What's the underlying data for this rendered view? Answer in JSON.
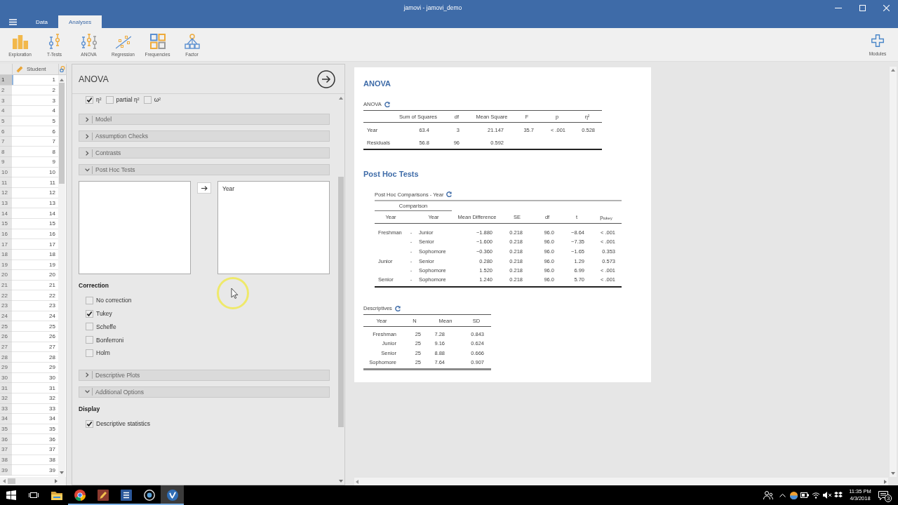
{
  "window": {
    "title": "jamovi - jamovi_demo"
  },
  "tabs": [
    {
      "label": "Data",
      "selected": false
    },
    {
      "label": "Analyses",
      "selected": true
    }
  ],
  "toolbar": {
    "items": [
      {
        "label": "Exploration",
        "kind": "exploration"
      },
      {
        "label": "T-Tests",
        "kind": "ttests"
      },
      {
        "label": "ANOVA",
        "kind": "anova"
      },
      {
        "label": "Regression",
        "kind": "regression"
      },
      {
        "label": "Frequencies",
        "kind": "frequencies"
      },
      {
        "label": "Factor",
        "kind": "factor"
      }
    ],
    "modules": {
      "label": "Modules"
    }
  },
  "spreadsheet": {
    "columns": [
      {
        "name": "Student",
        "kind": "continuous"
      },
      {
        "kind": "nominal"
      }
    ],
    "rows": [
      {
        "number": "1",
        "value": "1",
        "selected": true
      },
      {
        "number": "2",
        "value": "2",
        "selected": false
      },
      {
        "number": "3",
        "value": "3",
        "selected": false
      },
      {
        "number": "4",
        "value": "4",
        "selected": false
      },
      {
        "number": "5",
        "value": "5",
        "selected": false
      },
      {
        "number": "6",
        "value": "6",
        "selected": false
      },
      {
        "number": "7",
        "value": "7",
        "selected": false
      },
      {
        "number": "8",
        "value": "8",
        "selected": false
      },
      {
        "number": "9",
        "value": "9",
        "selected": false
      },
      {
        "number": "10",
        "value": "10",
        "selected": false
      },
      {
        "number": "11",
        "value": "11",
        "selected": false
      },
      {
        "number": "12",
        "value": "12",
        "selected": false
      },
      {
        "number": "13",
        "value": "13",
        "selected": false
      },
      {
        "number": "14",
        "value": "14",
        "selected": false
      },
      {
        "number": "15",
        "value": "15",
        "selected": false
      },
      {
        "number": "16",
        "value": "16",
        "selected": false
      },
      {
        "number": "17",
        "value": "17",
        "selected": false
      },
      {
        "number": "18",
        "value": "18",
        "selected": false
      },
      {
        "number": "19",
        "value": "19",
        "selected": false
      },
      {
        "number": "20",
        "value": "20",
        "selected": false
      },
      {
        "number": "21",
        "value": "21",
        "selected": false
      },
      {
        "number": "22",
        "value": "22",
        "selected": false
      },
      {
        "number": "23",
        "value": "23",
        "selected": false
      },
      {
        "number": "24",
        "value": "24",
        "selected": false
      },
      {
        "number": "25",
        "value": "25",
        "selected": false
      },
      {
        "number": "26",
        "value": "26",
        "selected": false
      },
      {
        "number": "27",
        "value": "27",
        "selected": false
      },
      {
        "number": "28",
        "value": "28",
        "selected": false
      },
      {
        "number": "29",
        "value": "29",
        "selected": false
      },
      {
        "number": "30",
        "value": "30",
        "selected": false
      },
      {
        "number": "31",
        "value": "31",
        "selected": false
      },
      {
        "number": "32",
        "value": "32",
        "selected": false
      },
      {
        "number": "33",
        "value": "33",
        "selected": false
      },
      {
        "number": "34",
        "value": "34",
        "selected": false
      },
      {
        "number": "35",
        "value": "35",
        "selected": false
      },
      {
        "number": "36",
        "value": "36",
        "selected": false
      },
      {
        "number": "37",
        "value": "37",
        "selected": false
      },
      {
        "number": "38",
        "value": "38",
        "selected": false
      },
      {
        "number": "39",
        "value": "39",
        "selected": false
      }
    ]
  },
  "options": {
    "title": "ANOVA",
    "effect_sizes": [
      {
        "label": "η²",
        "checked": true
      },
      {
        "label": "partial η²",
        "checked": false
      },
      {
        "label": "ω²",
        "checked": false
      }
    ],
    "sections": [
      {
        "label": "Model",
        "expanded": false
      },
      {
        "label": "Assumption Checks",
        "expanded": false
      },
      {
        "label": "Contrasts",
        "expanded": false
      },
      {
        "label": "Post Hoc Tests",
        "expanded": true,
        "terms": [
          "Year"
        ],
        "groups": [
          {
            "label": "Correction",
            "options": [
              {
                "label": "No correction",
                "checked": false
              },
              {
                "label": "Tukey",
                "checked": true
              },
              {
                "label": "Scheffe",
                "checked": false
              },
              {
                "label": "Bonferroni",
                "checked": false
              },
              {
                "label": "Holm",
                "checked": false
              }
            ]
          }
        ]
      },
      {
        "label": "Descriptive Plots",
        "expanded": false
      },
      {
        "label": "Additional Options",
        "expanded": true,
        "groups": [
          {
            "label": "Display",
            "options": [
              {
                "label": "Descriptive statistics",
                "checked": true
              }
            ]
          }
        ]
      }
    ]
  },
  "results": {
    "title": "ANOVA",
    "anova": {
      "title": "ANOVA",
      "columns": [
        "Sum of Squares",
        "df",
        "Mean Square",
        "F",
        "p",
        "η²"
      ],
      "rows": [
        {
          "term": "Year",
          "values": [
            "63.4",
            "3",
            "21.147",
            "35.7",
            "< .001",
            "0.528"
          ]
        },
        {
          "term": "Residuals",
          "values": [
            "56.8",
            "96",
            "0.592"
          ]
        }
      ]
    },
    "post_hoc": {
      "title": "Post Hoc Tests",
      "table": {
        "title": "Post Hoc Comparisons - Year",
        "group_header": "Comparison",
        "columns": [
          "Year",
          "Year",
          "Mean Difference",
          "SE",
          "df",
          "t",
          "p$_{tukey}$"
        ],
        "rows": [
          {
            "level_1": "Freshman",
            "separator": "-",
            "level_2": "Junior",
            "values": [
              "−1.880",
              "0.218",
              "96.0",
              "−8.64",
              "< .001"
            ]
          },
          {
            "separator": "-",
            "level_2": "Senior",
            "values": [
              "−1.600",
              "0.218",
              "96.0",
              "−7.35",
              "< .001"
            ]
          },
          {
            "separator": "-",
            "level_2": "Sophomore",
            "values": [
              "−0.360",
              "0.218",
              "96.0",
              "−1.65",
              "0.353"
            ]
          },
          {
            "level_1": "Junior",
            "separator": "-",
            "level_2": "Senior",
            "values": [
              "0.280",
              "0.218",
              "96.0",
              "1.29",
              "0.573"
            ]
          },
          {
            "separator": "-",
            "level_2": "Sophomore",
            "values": [
              "1.520",
              "0.218",
              "96.0",
              "6.99",
              "< .001"
            ]
          },
          {
            "level_1": "Senior",
            "separator": "-",
            "level_2": "Sophomore",
            "values": [
              "1.240",
              "0.218",
              "96.0",
              "5.70",
              "< .001"
            ]
          }
        ]
      }
    },
    "descriptives": {
      "title": "Descriptives",
      "columns": [
        "Year",
        "N",
        "Mean",
        "SD"
      ],
      "rows": [
        [
          "Freshman",
          "25",
          "7.28",
          "0.843"
        ],
        [
          "Junior",
          "25",
          "9.16",
          "0.624"
        ],
        [
          "Senior",
          "25",
          "8.88",
          "0.666"
        ],
        [
          "Sophomore",
          "25",
          "7.64",
          "0.907"
        ]
      ]
    }
  },
  "taskbar": {
    "apps": [
      {
        "kind": "folder",
        "running": false,
        "selected": false
      },
      {
        "kind": "browser",
        "running": true,
        "selected": false
      },
      {
        "kind": "sketch",
        "running": true,
        "selected": false
      },
      {
        "kind": "document",
        "running": true,
        "selected": false
      },
      {
        "kind": "media",
        "running": true,
        "selected": false
      },
      {
        "kind": "jamovi",
        "running": true,
        "selected": true
      }
    ],
    "time": "11:35 PM",
    "date": "4/3/2018",
    "notifications": "3"
  }
}
